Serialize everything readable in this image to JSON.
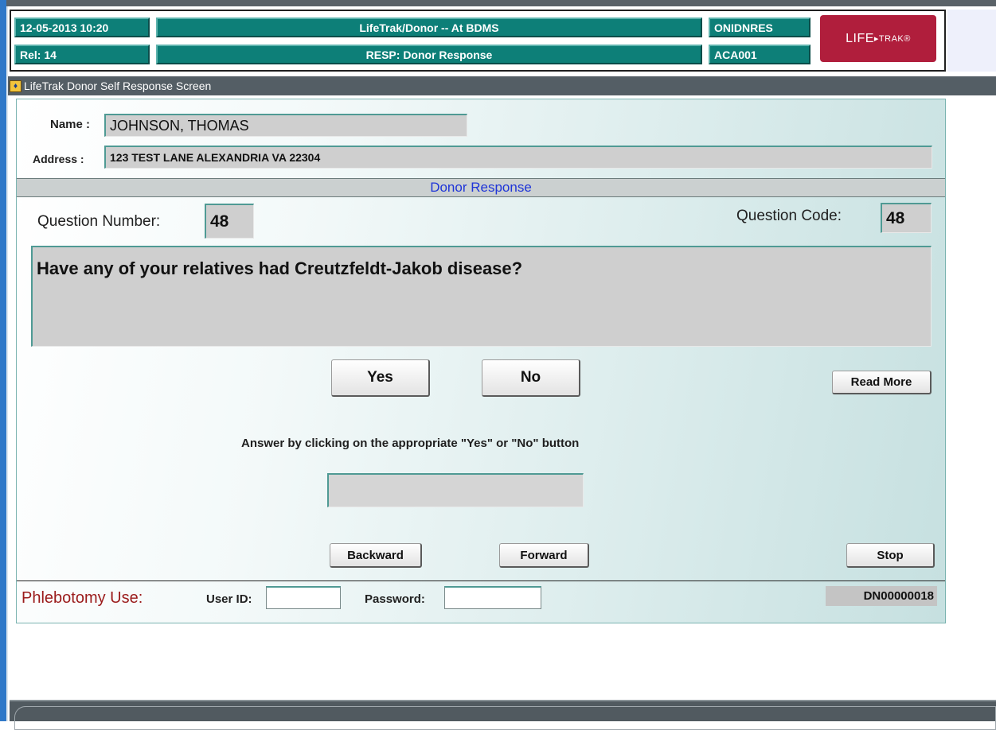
{
  "header": {
    "datetime": "12-05-2013  10:20",
    "release": "Rel: 14",
    "app_title": "LifeTrak/Donor -- At BDMS",
    "screen_title": "RESP: Donor Response",
    "code_top": "ONIDNRES",
    "code_bottom": "ACA001",
    "logo_text": "LIFE",
    "logo_small": "▸TRAK®"
  },
  "window": {
    "title": "LifeTrak Donor Self Response Screen",
    "icon": "app-icon"
  },
  "donor": {
    "name_label": "Name :",
    "name_value": "JOHNSON, THOMAS",
    "address_label": "Address :",
    "address_value": "123 TEST LANE  ALEXANDRIA VA 22304"
  },
  "section_title": "Donor Response",
  "question": {
    "number_label": "Question Number:",
    "number_value": "48",
    "code_label": "Question Code:",
    "code_value": "48",
    "text": "Have any of your relatives had Creutzfeldt-Jakob disease?"
  },
  "buttons": {
    "yes": "Yes",
    "no": "No",
    "read_more": "Read More",
    "backward": "Backward",
    "forward": "Forward",
    "stop": "Stop"
  },
  "instruction": "Answer by clicking on the appropriate \"Yes\"  or  \"No\" button",
  "answer_value": "",
  "phlebotomy": {
    "label": "Phlebotomy Use:",
    "user_id_label": "User ID:",
    "user_id_value": "",
    "password_label": "Password:",
    "password_value": "",
    "donor_id": "DN00000018"
  },
  "colors": {
    "header_teal": "#0d7f78",
    "logo_red": "#b01e3c",
    "section_blue_text": "#1f35d8",
    "phlebotomy_red": "#9b1b1b"
  }
}
